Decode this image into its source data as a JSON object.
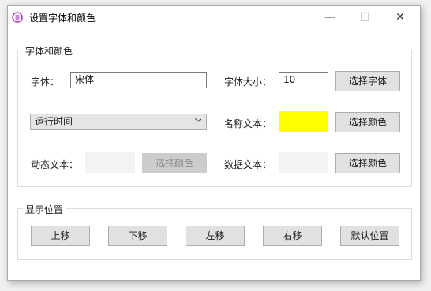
{
  "window": {
    "title": "设置字体和颜色",
    "controls": {
      "minimize": "—",
      "maximize": "☐",
      "close": "✕"
    }
  },
  "font_color_group": {
    "title": "字体和颜色",
    "font_label": "字体：",
    "font_value": "宋体",
    "font_size_label": "字体大小：",
    "font_size_value": "10",
    "select_font_button": "选择字体",
    "dropdown_value": "运行时间",
    "name_text_label": "名称文本：",
    "name_color": "#ffff00",
    "name_color_button": "选择颜色",
    "dynamic_text_label": "动态文本：",
    "dynamic_color": "#f4f3f2",
    "dynamic_color_button": "选择颜色",
    "data_text_label": "数据文本：",
    "data_color": "#f4f3f2",
    "data_color_button": "选择颜色"
  },
  "position_group": {
    "title": "显示位置",
    "up": "上移",
    "down": "下移",
    "left": "左移",
    "right": "右移",
    "default": "默认位置"
  }
}
